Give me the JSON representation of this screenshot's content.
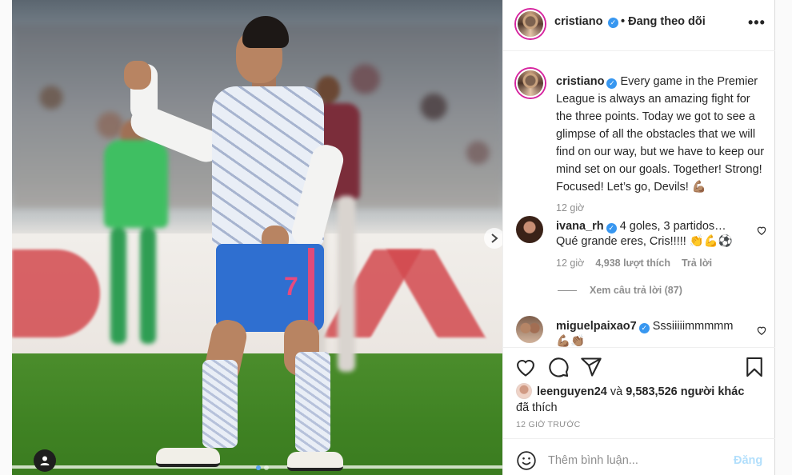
{
  "post": {
    "username": "cristiano",
    "follow_status": "Đang theo dõi",
    "more": "•••",
    "dot": "•",
    "verified_mark": "✓"
  },
  "caption": {
    "username": "cristiano",
    "text": "Every game in the Premier League is always an amazing fight for the three points. Today we got to see a glimpse of all the obstacles that we will find on our way, but we have to keep our mind set on our goals. Together! Strong! Focused! Let’s go, Devils! 💪🏽",
    "time": "12 giờ"
  },
  "comments": [
    {
      "username": "ivana_rh",
      "text": "4 goles, 3 partidos… Qué grande eres, Cris!!!!! 👏💪⚽",
      "time": "12 giờ",
      "likes": "4,938 lượt thích",
      "reply": "Trả lời",
      "view_replies": "Xem câu trả lời (87)"
    },
    {
      "username": "miguelpaixao7",
      "text": "Sssiiiiimmmmm 💪🏽👏🏽"
    }
  ],
  "likes": {
    "first_liker": "leenguyen24",
    "connector": "và",
    "others": "9,583,526 người khác",
    "suffix": "đã thích"
  },
  "timestamp": "12 GIỜ TRƯỚC",
  "add_comment": {
    "placeholder": "Thêm bình luận...",
    "post_label": "Đăng"
  },
  "photo": {
    "jersey_number": "7"
  },
  "icons": {
    "like": "heart-icon",
    "comment": "comment-icon",
    "share": "share-icon",
    "save": "bookmark-icon",
    "emoji": "emoji-icon",
    "next": "chevron-right-icon",
    "tag": "user-tag-icon"
  },
  "colors": {
    "verified": "#3897f0",
    "post_disabled": "#b2dffc",
    "story_ring": "#d6249f"
  }
}
